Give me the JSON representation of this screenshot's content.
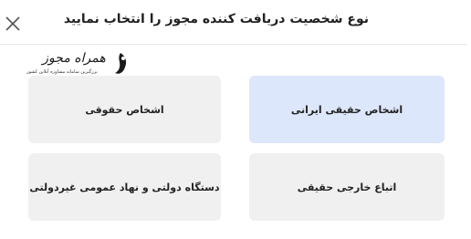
{
  "header": {
    "title": "نوع شخصیت دریافت کننده مجوز را انتخاب نمایید"
  },
  "close_icon": "close-icon",
  "logo": {
    "main_text": "همراه مجوز",
    "sub_text": "بزرگترین سامانه مشاوره آنلاین کشور"
  },
  "options": [
    {
      "label": "اشخاص حقیقی ایرانی",
      "selected": true
    },
    {
      "label": "اشخاص حقوقی",
      "selected": false
    },
    {
      "label": "اتباع خارجی حقیقی",
      "selected": false
    },
    {
      "label": "دستگاه دولتی و نهاد عمومی غیردولتی",
      "selected": false
    }
  ],
  "colors": {
    "selected_bg": "#dde7fb",
    "option_bg": "#f0f0f0",
    "text": "#222222"
  }
}
